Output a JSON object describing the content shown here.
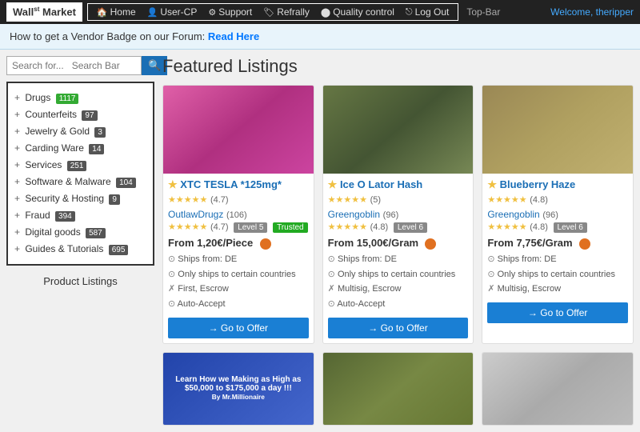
{
  "topbar": {
    "logo": "Wall",
    "logo_sup": "st",
    "logo_suffix": " Market",
    "nav_items": [
      {
        "label": "Home",
        "icon": "🏠"
      },
      {
        "label": "User-CP",
        "icon": "👤"
      },
      {
        "label": "Support",
        "icon": "⚙"
      },
      {
        "label": "Refrally",
        "icon": "🏷"
      },
      {
        "label": "Quality control",
        "icon": "⬤"
      },
      {
        "label": "Log Out",
        "icon": "⎋"
      }
    ],
    "label": "Top-Bar",
    "welcome_prefix": "Welcome, ",
    "username": "theripper"
  },
  "banner": {
    "text": "How to get a Vendor Badge on our Forum:",
    "link": "Read Here"
  },
  "sidebar": {
    "search_placeholder": "Search for...",
    "search_label": "Search Bar",
    "categories": [
      {
        "label": "Drugs",
        "count": "1117",
        "badge_class": "green"
      },
      {
        "label": "Counterfeits",
        "count": "97",
        "badge_class": ""
      },
      {
        "label": "Jewelry & Gold",
        "count": "3",
        "badge_class": ""
      },
      {
        "label": "Carding Ware",
        "count": "14",
        "badge_class": ""
      },
      {
        "label": "Services",
        "count": "251",
        "badge_class": ""
      },
      {
        "label": "Software & Malware",
        "count": "104",
        "badge_class": ""
      },
      {
        "label": "Security & Hosting",
        "count": "9",
        "badge_class": ""
      },
      {
        "label": "Fraud",
        "count": "394",
        "badge_class": ""
      },
      {
        "label": "Digital goods",
        "count": "587",
        "badge_class": ""
      },
      {
        "label": "Guides & Tutorials",
        "count": "695",
        "badge_class": ""
      }
    ],
    "product_listings": "Product Listings"
  },
  "content": {
    "featured_title": "Featured Listings",
    "listings": [
      {
        "title": "XTC TESLA *125mg*",
        "stars": "★★★★★",
        "rating": "(4.7)",
        "seller": "OutlawDrugz",
        "seller_count": "(106)",
        "seller_stars": "★★★★★",
        "seller_rating": "(4.7)",
        "level": "Level 5",
        "trusted": "Trusted",
        "price": "From 1,20€/Piece",
        "ships": "Ships from: DE",
        "info1": "Only ships to certain countries",
        "info2": "First, Escrow",
        "info3": "Auto-Accept",
        "btn": "→ Go to Offer",
        "img_class": "listing-img-1"
      },
      {
        "title": "Ice O Lator Hash",
        "stars": "★★★★★",
        "rating": "(5)",
        "seller": "Greengoblin",
        "seller_count": "(96)",
        "seller_stars": "★★★★★",
        "seller_rating": "(4.8)",
        "level": "Level 6",
        "trusted": "",
        "price": "From 15,00€/Gram",
        "ships": "Ships from: DE",
        "info1": "Only ships to certain countries",
        "info2": "Multisig, Escrow",
        "info3": "Auto-Accept",
        "btn": "→ Go to Offer",
        "img_class": "listing-img-2"
      },
      {
        "title": "Blueberry Haze",
        "stars": "★★★★★",
        "rating": "(4.8)",
        "seller": "Greengoblin",
        "seller_count": "(96)",
        "seller_stars": "★★★★★",
        "seller_rating": "(4.8)",
        "level": "Level 6",
        "trusted": "",
        "price": "From 7,75€/Gram",
        "ships": "Ships from: DE",
        "info1": "Only ships to certain countries",
        "info2": "Multisig, Escrow",
        "info3": "",
        "btn": "→ Go to Offer",
        "img_class": "listing-img-3"
      }
    ],
    "bottom_listings_placeholder": [
      {
        "img_class": "listing-img-4",
        "label": "Learn How we Making as High as $50,000 to $175,000 a day !!!"
      },
      {
        "img_class": "listing-img-5",
        "label": ""
      },
      {
        "img_class": "listing-img-6",
        "label": ""
      }
    ]
  }
}
